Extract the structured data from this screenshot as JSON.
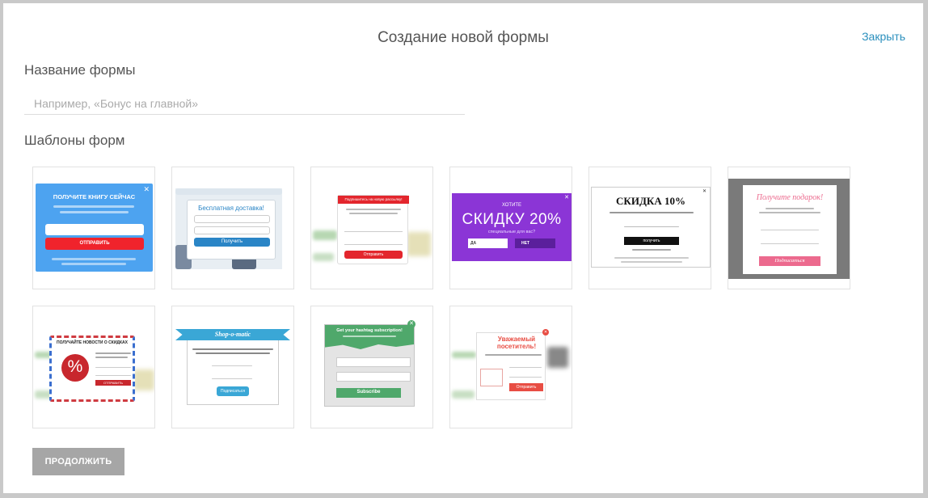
{
  "header": {
    "title": "Создание новой формы",
    "close_label": "Закрыть"
  },
  "form_name": {
    "label": "Название формы",
    "placeholder": "Например, «Бонус на главной»",
    "value": ""
  },
  "templates_section": {
    "label": "Шаблоны форм"
  },
  "templates": [
    {
      "heading": "ПОЛУЧИТЕ КНИГУ СЕЙЧАС",
      "button": "ОТПРАВИТЬ",
      "accent": "#4da3f0",
      "button_color": "#f0232c"
    },
    {
      "heading": "Бесплатная доставка!",
      "button": "Получить",
      "accent": "#2a85c6"
    },
    {
      "heading": "Подпишитесь на новую рассылку!",
      "button": "Отправить",
      "accent": "#e3262d"
    },
    {
      "heading": "ХОТИТЕ",
      "big": "СКИДКУ 20%",
      "sub": "специальные для вас?",
      "yes": "ДА",
      "no": "НЕТ",
      "accent": "#8b35d6"
    },
    {
      "heading": "СКИДКА 10%",
      "button": "получить",
      "accent": "#111111"
    },
    {
      "heading": "Получите подарок!",
      "button": "Подписаться",
      "accent": "#ec6a8e"
    },
    {
      "heading": "ПОЛУЧАЙТЕ НОВОСТИ О СКИДКАХ",
      "symbol": "%",
      "button": "ОТПРАВИТЬ",
      "accent": "#c8272d"
    },
    {
      "heading": "Shop-o-matic",
      "button": "Подписаться",
      "accent": "#3aa7d6"
    },
    {
      "heading": "Get your hashtag subscription!",
      "button": "Subscribe",
      "accent": "#4fa86b"
    },
    {
      "heading": "Уважаемый посетитель!",
      "button": "Отправить",
      "accent": "#e84d43"
    }
  ],
  "actions": {
    "continue_label": "ПРОДОЛЖИТЬ"
  }
}
